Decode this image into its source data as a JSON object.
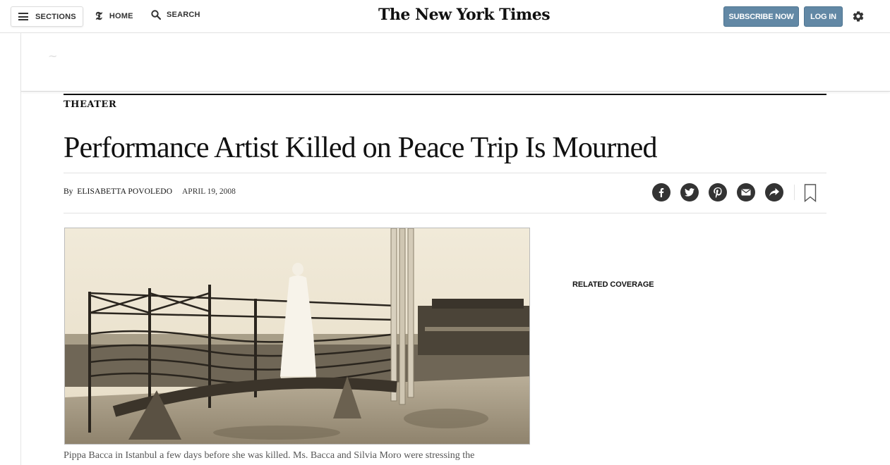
{
  "header": {
    "sections_label": "SECTIONS",
    "home_label": "HOME",
    "search_label": "SEARCH",
    "logo_text": "The New York Times",
    "subscribe_label": "SUBSCRIBE NOW",
    "login_label": "LOG IN"
  },
  "article": {
    "kicker": "THEATER",
    "headline": "Performance Artist Killed on Peace Trip Is Mourned",
    "byline_prefix": "By",
    "author": "ELISABETTA POVOLEDO",
    "date": "APRIL 19, 2008",
    "caption": "Pippa Bacca in Istanbul a few days before she was killed. Ms. Bacca and Silvia Moro were stressing the"
  },
  "share_icons": [
    "facebook-icon",
    "twitter-icon",
    "pinterest-icon",
    "email-icon",
    "share-icon"
  ],
  "sidebar": {
    "related_label": "RELATED COVERAGE"
  },
  "colors": {
    "button_blue": "#6288a5",
    "icon_dark": "#333333",
    "photo_sepia": "#d8cfbd"
  }
}
